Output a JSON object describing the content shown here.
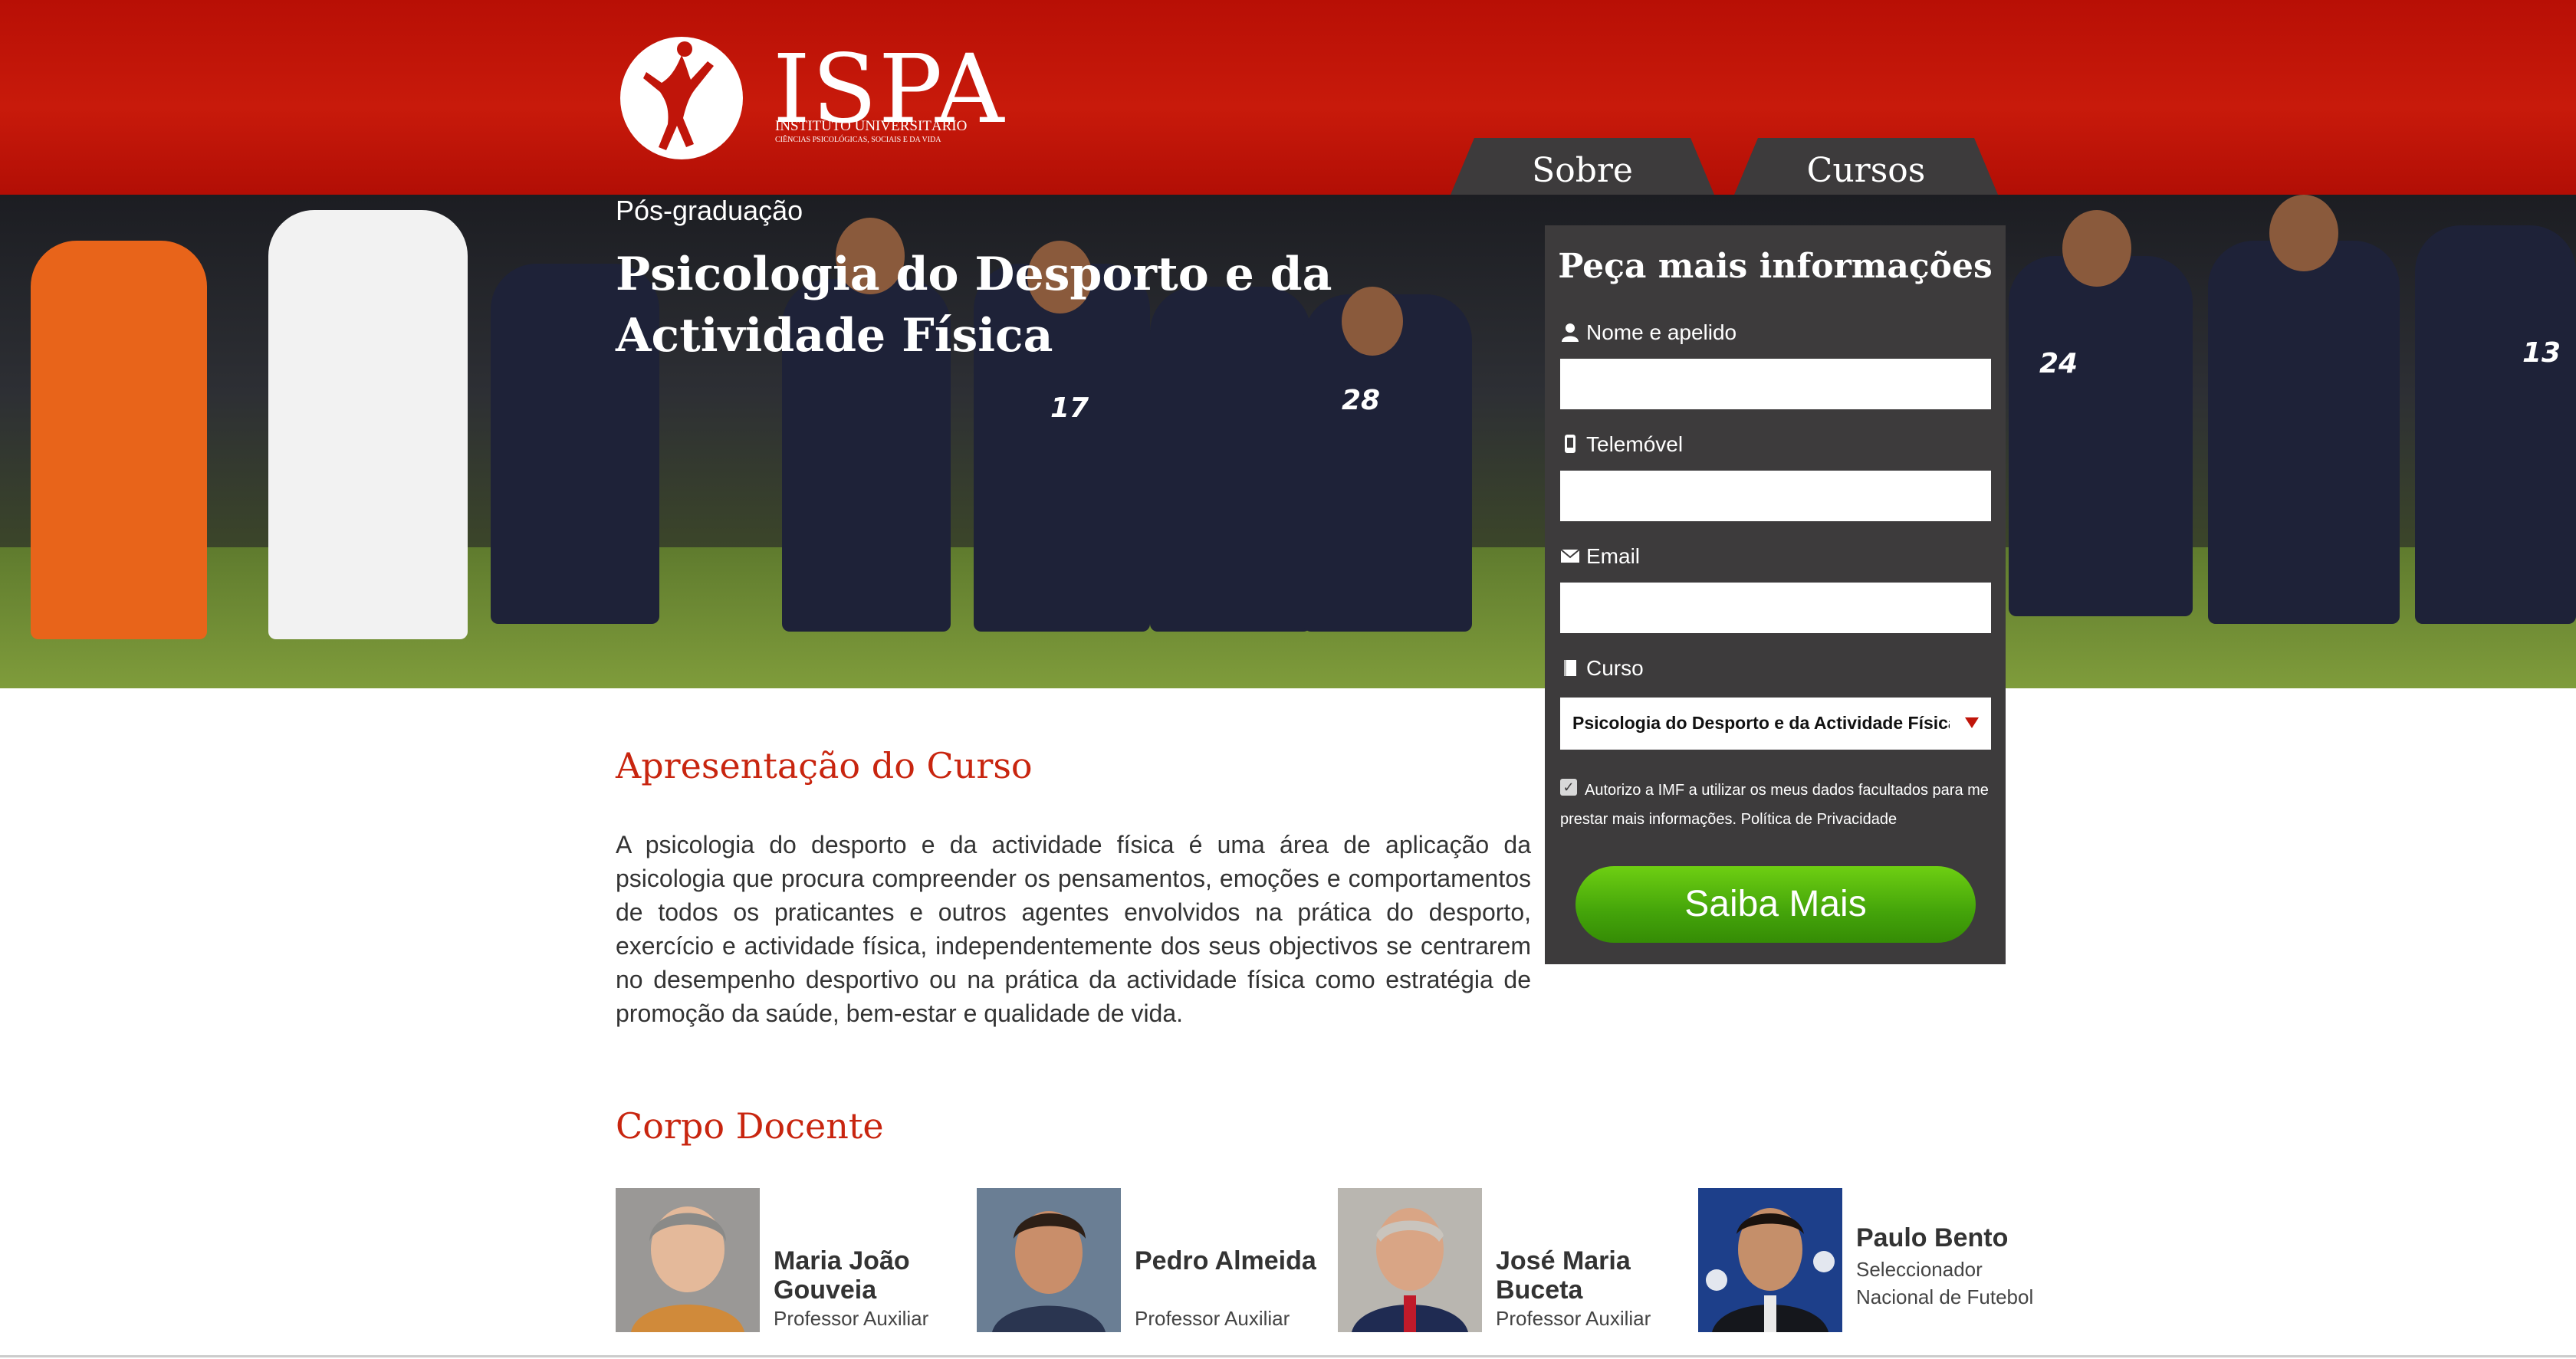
{
  "header": {
    "logo_word": "ISPA",
    "logo_subtitle": "INSTITUTO UNIVERSITÁRIO",
    "logo_tagline": "CIÊNCIAS PSICOLÓGICAS, SOCIAIS E DA VIDA",
    "tabs": [
      {
        "label": "Sobre"
      },
      {
        "label": "Cursos"
      }
    ]
  },
  "hero": {
    "subtitle": "Pós-graduação",
    "title": "Psicologia do Desporto e da Actividade Física"
  },
  "form": {
    "title": "Peça mais informações",
    "name_label": "Nome e apelido",
    "phone_label": "Telemóvel",
    "email_label": "Email",
    "course_label": "Curso",
    "course_value": "Psicologia do Desporto e da Actividade Física",
    "consent_checked": true,
    "consent_text": "Autorizo a IMF a utilizar os meus dados facultados para me prestar mais informações. Política de Privacidade",
    "submit_label": "Saiba Mais"
  },
  "content": {
    "presentation_heading": "Apresentação do Curso",
    "presentation_text": "A psicologia do desporto e da actividade física é uma área de aplicação da psicologia que procura compreender os pensamentos, emoções e comportamentos de todos os praticantes e outros agentes envolvidos na prática do desporto, exercício e actividade física, independentemente dos seus objectivos se centrarem no desempenho desportivo ou na prática da actividade física como estratégia de promoção da saúde, bem-estar e qualidade de vida.",
    "faculty_heading": "Corpo Docente"
  },
  "faculty": [
    {
      "name": "Maria João Gouveia",
      "role": "Professor Auxiliar"
    },
    {
      "name": "Pedro Almeida",
      "role": "Professor Auxiliar"
    },
    {
      "name": "José Maria Buceta",
      "role": "Professor Auxiliar"
    },
    {
      "name": "Paulo Bento",
      "role": "Seleccionador Nacional de Futebol"
    }
  ],
  "colors": {
    "header_red": "#c81a0b",
    "panel_dark": "#3d3b3c",
    "heading_red": "#c8250f",
    "button_green": "#4fb20c"
  },
  "icons": [
    "user-icon",
    "phone-icon",
    "envelope-icon",
    "book-icon",
    "chevron-down-icon",
    "checkbox-icon"
  ]
}
